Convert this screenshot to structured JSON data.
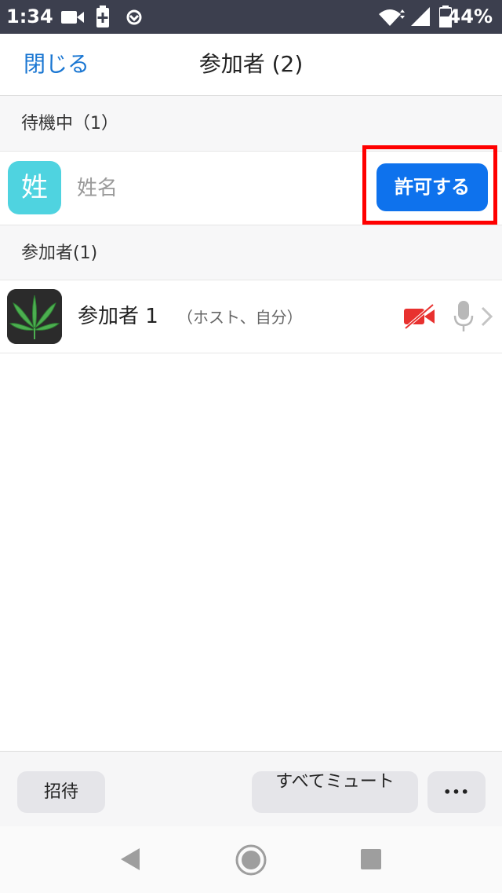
{
  "status_bar": {
    "time": "1:34",
    "battery_percent": "44%",
    "icons": [
      "video-camera-icon",
      "battery-saver-icon",
      "sync-icon",
      "wifi-icon",
      "cell-signal-icon",
      "battery-icon"
    ]
  },
  "header": {
    "close_label": "閉じる",
    "title": "参加者 (2)"
  },
  "waiting_section": {
    "label": "待機中（1）",
    "items": [
      {
        "avatar_letter": "姓",
        "name": "姓名",
        "admit_label": "許可する"
      }
    ]
  },
  "participants_section": {
    "label": "参加者(1)",
    "items": [
      {
        "name": "参加者 1",
        "tag": "（ホスト、自分）",
        "video": "off",
        "audio": "on"
      }
    ]
  },
  "toolbar": {
    "invite_label": "招待",
    "mute_all_label": "すべてミュート",
    "more_label": "•••"
  },
  "colors": {
    "accent": "#0e72ed",
    "link": "#1976d2",
    "highlight": "#ff0000",
    "avatar_bg": "#4fd3e0",
    "video_off": "#e8312f"
  }
}
